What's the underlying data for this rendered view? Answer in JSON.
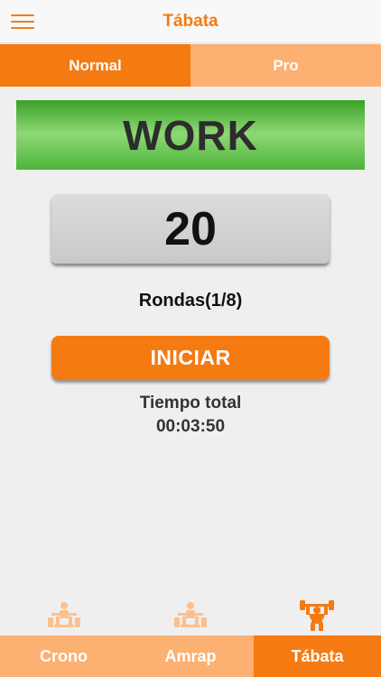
{
  "nav": {
    "title": "Tábata",
    "menu_icon": "hamburger-menu-icon"
  },
  "segments": {
    "normal": "Normal",
    "pro": "Pro",
    "selected": "Normal"
  },
  "timer": {
    "phase": "WORK",
    "phase_color": "#4db43a",
    "seconds": "20",
    "rounds": "Rondas(1/8)",
    "start_label": "INICIAR",
    "total_label": "Tiempo total",
    "total_value": "00:03:50"
  },
  "tabs": [
    {
      "label": "Crono",
      "icon": "weightlifter-icon",
      "selected": false
    },
    {
      "label": "Amrap",
      "icon": "weightlifter-icon",
      "selected": false
    },
    {
      "label": "Tábata",
      "icon": "weightlifter-overhead-icon",
      "selected": true
    }
  ],
  "colors": {
    "accent": "#f57a12",
    "accent_light": "#fcb072",
    "background": "#efefef"
  }
}
